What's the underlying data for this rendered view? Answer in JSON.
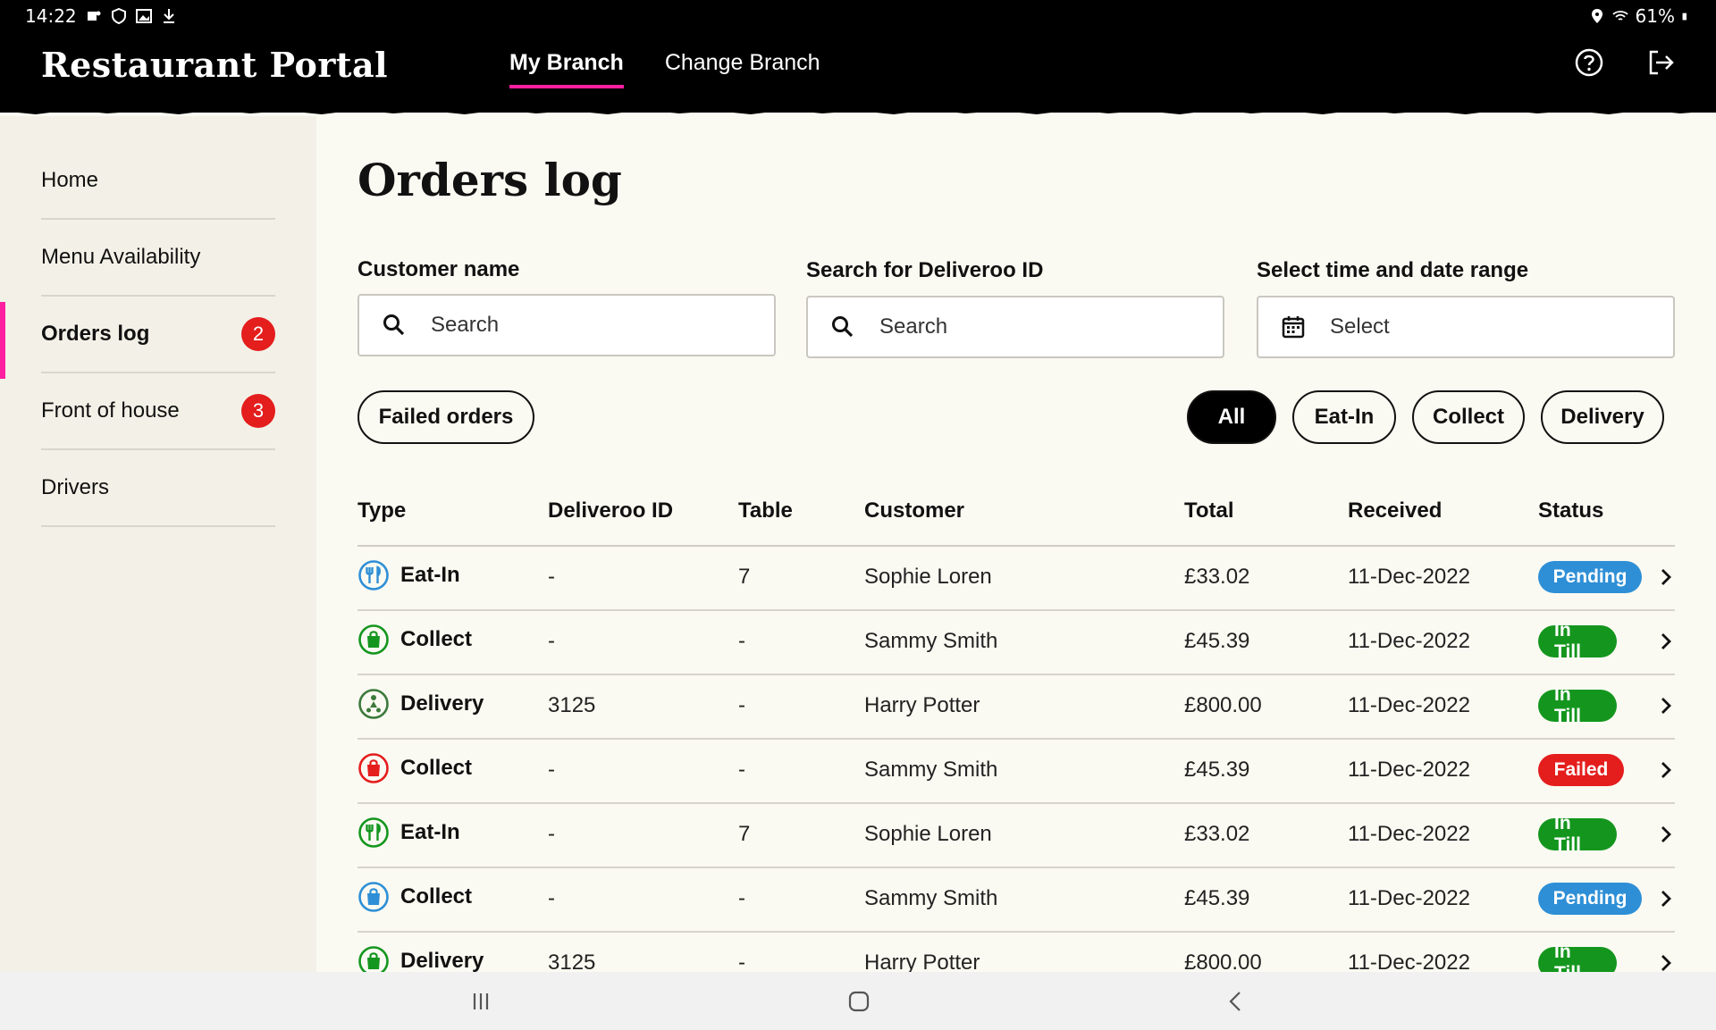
{
  "status_bar": {
    "time": "14:22",
    "battery": "61%"
  },
  "header": {
    "brand": "Restaurant Portal",
    "tabs": [
      {
        "label": "My Branch",
        "active": true
      },
      {
        "label": "Change Branch",
        "active": false
      }
    ],
    "icons": [
      "help-icon",
      "logout-icon"
    ],
    "accent_color": "#ff1fa0"
  },
  "sidebar": {
    "items": [
      {
        "label": "Home",
        "badge": ""
      },
      {
        "label": "Menu Availability",
        "badge": ""
      },
      {
        "label": "Orders log",
        "badge": "2",
        "active": true
      },
      {
        "label": "Front of house",
        "badge": "3"
      },
      {
        "label": "Drivers",
        "badge": ""
      }
    ]
  },
  "main": {
    "title": "Orders log",
    "filters": {
      "customer_label": "Customer name",
      "customer_placeholder": "Search",
      "deliveroo_label": "Search for Deliveroo ID",
      "deliveroo_placeholder": "Search",
      "date_label": "Select time and date range",
      "date_placeholder": "Select"
    },
    "failed_orders_button": "Failed orders",
    "type_filters": [
      "All",
      "Eat-In",
      "Collect",
      "Delivery"
    ],
    "active_type_filter": "All",
    "columns": [
      "Type",
      "Deliveroo ID",
      "Table",
      "Customer",
      "Total",
      "Received",
      "Status"
    ],
    "rows": [
      {
        "type": "Eat-In",
        "icon": "cutlery-icon",
        "icon_color": "#2e8fd6",
        "deliveroo_id": "-",
        "table": "7",
        "customer": "Sophie Loren",
        "total": "£33.02",
        "received": "11-Dec-2022",
        "status": "Pending",
        "status_color": "#2e8fd6"
      },
      {
        "type": "Collect",
        "icon": "bag-icon",
        "icon_color": "#14961e",
        "deliveroo_id": "-",
        "table": "-",
        "customer": "Sammy Smith",
        "total": "£45.39",
        "received": "11-Dec-2022",
        "status": "In Till",
        "status_color": "#14961e"
      },
      {
        "type": "Delivery",
        "icon": "scooter-icon",
        "icon_color": "#3b7a3b",
        "deliveroo_id": "3125",
        "table": "-",
        "customer": "Harry Potter",
        "total": "£800.00",
        "received": "11-Dec-2022",
        "status": "In Till",
        "status_color": "#14961e"
      },
      {
        "type": "Collect",
        "icon": "bag-icon",
        "icon_color": "#e41d1d",
        "deliveroo_id": "-",
        "table": "-",
        "customer": "Sammy Smith",
        "total": "£45.39",
        "received": "11-Dec-2022",
        "status": "Failed",
        "status_color": "#e41d1d"
      },
      {
        "type": "Eat-In",
        "icon": "cutlery-icon",
        "icon_color": "#14961e",
        "deliveroo_id": "-",
        "table": "7",
        "customer": "Sophie Loren",
        "total": "£33.02",
        "received": "11-Dec-2022",
        "status": "In Till",
        "status_color": "#14961e"
      },
      {
        "type": "Collect",
        "icon": "bag-icon",
        "icon_color": "#2e8fd6",
        "deliveroo_id": "-",
        "table": "-",
        "customer": "Sammy Smith",
        "total": "£45.39",
        "received": "11-Dec-2022",
        "status": "Pending",
        "status_color": "#2e8fd6"
      },
      {
        "type": "Delivery",
        "icon": "bag-icon",
        "icon_color": "#14961e",
        "deliveroo_id": "3125",
        "table": "-",
        "customer": "Harry Potter",
        "total": "£800.00",
        "received": "11-Dec-2022",
        "status": "In Till",
        "status_color": "#14961e"
      }
    ]
  }
}
